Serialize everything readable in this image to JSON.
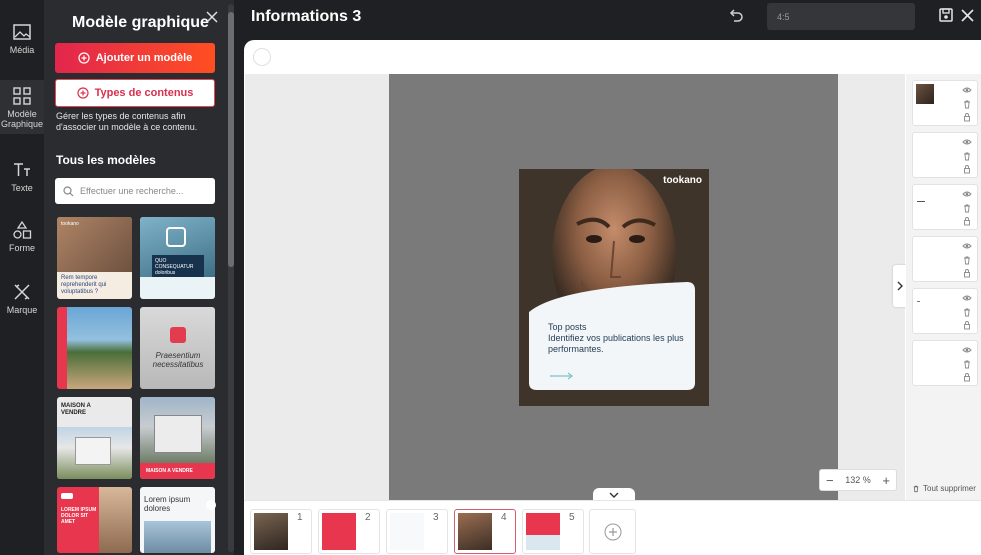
{
  "rail": [
    {
      "label": "Média",
      "icon": "image-icon"
    },
    {
      "label": "Modèle Graphique",
      "icon": "grid-icon"
    },
    {
      "label": "Texte",
      "icon": "text-icon"
    },
    {
      "label": "Forme",
      "icon": "shapes-icon"
    },
    {
      "label": "Marque",
      "icon": "brand-icon"
    }
  ],
  "panel": {
    "title": "Modèle graphique",
    "add_label": "Ajouter un modèle",
    "types_label": "Types de contenus",
    "description": "Gérer les types de contenus afin d'associer un modèle à ce contenu.",
    "section_title": "Tous les modèles",
    "search_placeholder": "Effectuer une recherche...",
    "thumbs": [
      {
        "caption": "Rem tempore reprehenderit qui voluptatibus ?"
      },
      {
        "caption": "QUO CONSEQUATUR doloribus"
      },
      {
        "caption": ""
      },
      {
        "caption": "Praesentium necessitatibus"
      },
      {
        "caption": "MAISON A VENDRE"
      },
      {
        "caption": "MAISON A VENDRE"
      },
      {
        "caption": "LOREM IPSUM DOLOR SIT AMET"
      },
      {
        "caption": "Lorem ipsum dolores"
      }
    ]
  },
  "topbar": {
    "title": "Informations 3",
    "ratio": "4:5"
  },
  "card": {
    "brand": "tookano",
    "line1": "Top posts",
    "line2": "Identifiez vos publications les plus performantes."
  },
  "zoom": {
    "value": "132 %"
  },
  "clear_all": "Tout supprimer",
  "pages": [
    "1",
    "2",
    "3",
    "4",
    "5"
  ],
  "colors": {
    "accent": "#e2264d",
    "accent2": "#ff4f22",
    "panel": "#2b2c30"
  }
}
